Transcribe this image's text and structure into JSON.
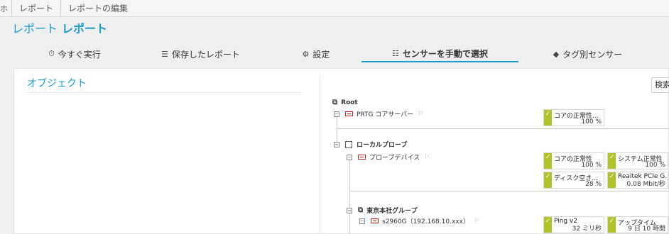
{
  "breadcrumb": {
    "home": "ホ",
    "items": [
      "レポート",
      "レポートの編集"
    ]
  },
  "title": {
    "prefix": "レポート",
    "name": "レポート"
  },
  "tabs": [
    {
      "label": "今すぐ実行",
      "icon": "stopwatch-icon",
      "glyph": "⏱"
    },
    {
      "label": "保存したレポート",
      "icon": "database-icon",
      "glyph": "☰"
    },
    {
      "label": "設定",
      "icon": "gear-icon",
      "glyph": "⚙"
    },
    {
      "label": "センサーを手動で選択",
      "icon": "sliders-icon",
      "glyph": "☷",
      "active": true
    },
    {
      "label": "タグ別センサー",
      "icon": "tag-icon",
      "glyph": "◆"
    }
  ],
  "objects": {
    "title": "オブジェクト"
  },
  "search": {
    "label": "検索"
  },
  "tree": {
    "root": "Root",
    "prtg_server": "PRTG コアサーバー",
    "local_probe": "ローカルプローブ",
    "probe_device": "プローブデバイス",
    "group": "東京本社グループ",
    "switch": "s2960G（192.168.10.xxx）"
  },
  "sensors": [
    {
      "name": "コアの正常性...",
      "value": "100 %"
    },
    {
      "name": "コアの正常性",
      "value": "100 %"
    },
    {
      "name": "システム正常性",
      "value": "100 %"
    },
    {
      "name": "ディスク空き...",
      "value": "28 %"
    },
    {
      "name": "Realtek PCIe G...",
      "value": "0.08 Mbit/秒"
    },
    {
      "name": "Ping v2",
      "value": "32 ミリ秒"
    },
    {
      "name": "アップタイム",
      "value": "9 日 10 時間"
    }
  ],
  "colors": {
    "accent": "#1a9bcf",
    "status_up": "#b3c22a"
  }
}
